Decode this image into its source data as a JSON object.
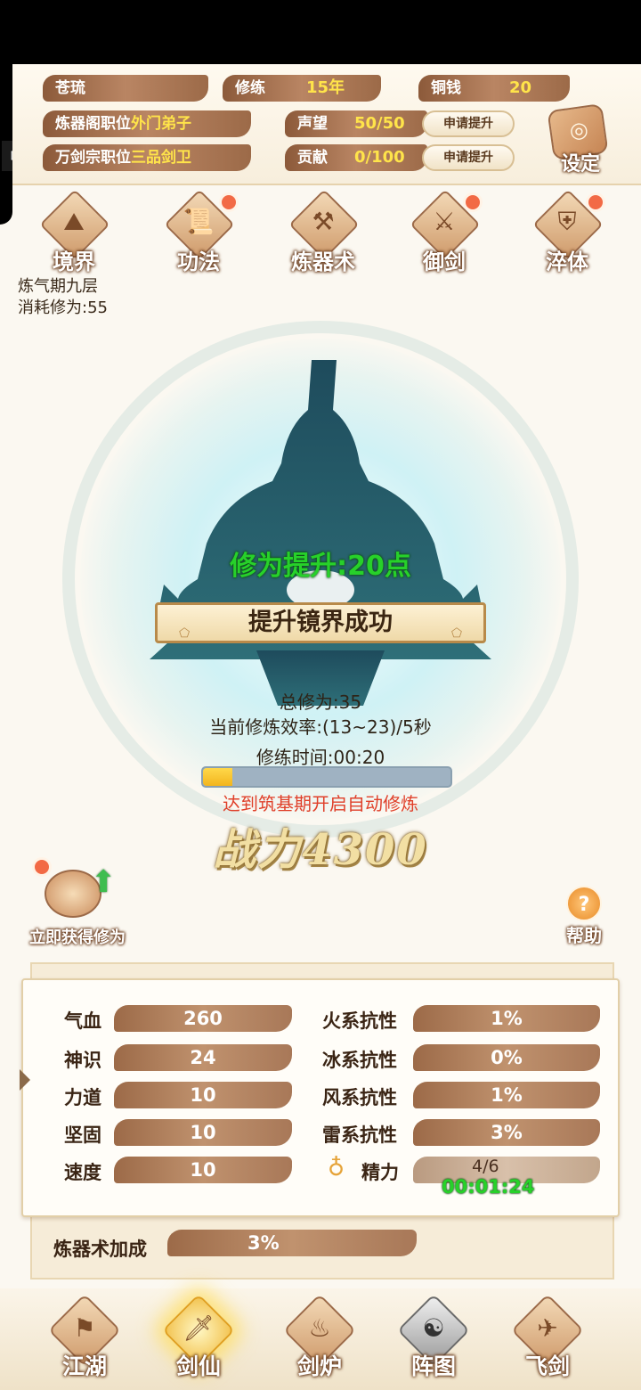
{
  "colors": {
    "accent_gold": "#ffe44a",
    "gain_green": "#27d12a",
    "warning_red": "#e0402a",
    "brush_brown": "#9c6a48",
    "notify_dot": "#f26a45"
  },
  "player": {
    "name": "苍琉",
    "cultivation_label": "修练",
    "cultivation_value": "15年",
    "copper_label": "铜钱",
    "copper_value": "20",
    "refinery_post_label": "炼器阁职位",
    "refinery_post_value": "外门弟子",
    "sect_post_label": "万剑宗职位",
    "sect_post_value": "三品剑卫",
    "reputation_label": "声望",
    "reputation_value": "50/50",
    "contribution_label": "贡献",
    "contribution_value": "0/100",
    "apply_label": "申请提升",
    "settings_label": "设定"
  },
  "features": [
    {
      "label": "境界",
      "icon": "mountain-icon",
      "has_dot": false
    },
    {
      "label": "功法",
      "icon": "scroll-icon",
      "has_dot": true
    },
    {
      "label": "炼器术",
      "icon": "forge-icon",
      "has_dot": false
    },
    {
      "label": "御剑",
      "icon": "sword-icon",
      "has_dot": true
    },
    {
      "label": "淬体",
      "icon": "armor-icon",
      "has_dot": true
    }
  ],
  "realm": {
    "level": "炼气期九层",
    "cost": "消耗修为:55"
  },
  "center": {
    "gain_text": "修为提升:20点",
    "banner_text": "提升镜界成功",
    "total": "总修为:35",
    "efficiency": "当前修炼效率:(13~23)/5秒",
    "time": "修练时间:00:20",
    "progress": 0.12,
    "auto_note": "达到筑基期开启自动修炼",
    "power": "战力4300"
  },
  "actions": {
    "quick_gain_label": "立即获得修为",
    "help_label": "帮助",
    "help_icon": "question-icon",
    "quick_gain_icon": "up-arrow-icon"
  },
  "stats": {
    "left": [
      {
        "label": "气血",
        "value": "260"
      },
      {
        "label": "神识",
        "value": "24"
      },
      {
        "label": "力道",
        "value": "10"
      },
      {
        "label": "坚固",
        "value": "10"
      },
      {
        "label": "速度",
        "value": "10"
      }
    ],
    "right": [
      {
        "label": "火系抗性",
        "value": "1%"
      },
      {
        "label": "冰系抗性",
        "value": "0%"
      },
      {
        "label": "风系抗性",
        "value": "1%"
      },
      {
        "label": "雷系抗性",
        "value": "3%"
      }
    ],
    "energy_label": "精力",
    "energy_value": "4/6",
    "energy_timer": "00:01:24",
    "energy_icon": "gourd-icon",
    "bonus_label": "炼器术加成",
    "bonus_value": "3%"
  },
  "nav": [
    {
      "label": "江湖",
      "icon": "banner-icon"
    },
    {
      "label": "剑仙",
      "icon": "sword-immortal-icon",
      "active": true
    },
    {
      "label": "剑炉",
      "icon": "furnace-icon"
    },
    {
      "label": "阵图",
      "icon": "yinyang-icon"
    },
    {
      "label": "飞剑",
      "icon": "flying-sword-icon"
    }
  ]
}
